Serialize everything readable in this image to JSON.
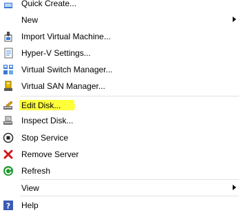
{
  "menu": {
    "items": [
      {
        "label": "Quick Create...",
        "icon": "quick-create-icon"
      },
      {
        "label": "New",
        "icon": "",
        "submenu": true
      },
      {
        "label": "Import Virtual Machine...",
        "icon": "import-vm-icon"
      },
      {
        "label": "Hyper-V Settings...",
        "icon": "hyperv-settings-icon"
      },
      {
        "label": "Virtual Switch Manager...",
        "icon": "virtual-switch-manager-icon"
      },
      {
        "label": "Virtual SAN Manager...",
        "icon": "virtual-san-manager-icon"
      },
      {
        "label": "Edit Disk...",
        "icon": "edit-disk-icon",
        "highlighted": true
      },
      {
        "label": "Inspect Disk...",
        "icon": "inspect-disk-icon"
      },
      {
        "label": "Stop Service",
        "icon": "stop-service-icon"
      },
      {
        "label": "Remove Server",
        "icon": "remove-server-icon"
      },
      {
        "label": "Refresh",
        "icon": "refresh-icon"
      },
      {
        "label": "View",
        "icon": "",
        "submenu": true
      },
      {
        "label": "Help",
        "icon": "help-icon"
      }
    ]
  },
  "colors": {
    "highlight": "#ffff3a",
    "separator": "#e2e2e2",
    "remove_red": "#d01818",
    "refresh_green": "#1e9a2e",
    "help_blue": "#3b5bb5"
  }
}
